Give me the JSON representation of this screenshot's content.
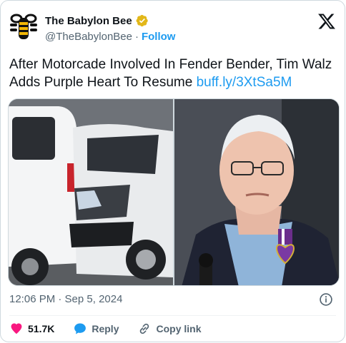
{
  "author": {
    "display_name": "The Babylon Bee",
    "handle": "@TheBabylonBee",
    "separator": "·",
    "follow_label": "Follow"
  },
  "tweet": {
    "text": "After Motorcade Involved In Fender Bender, Tim Walz Adds Purple Heart To Resume",
    "link": "buff.ly/3XtSa5M"
  },
  "meta": {
    "timestamp": "12:06 PM · Sep 5, 2024"
  },
  "actions": {
    "likes": "51.7K",
    "reply_label": "Reply",
    "copy_link_label": "Copy link"
  },
  "icons": {
    "avatar": "babylon-bee-logo",
    "verified": "verified-badge-icon",
    "platform": "x-logo-icon",
    "info": "info-icon",
    "like": "heart-icon",
    "reply": "reply-bubble-icon",
    "copy": "link-icon"
  },
  "colors": {
    "accent": "#1d9bf0",
    "like": "#f91880",
    "verified": "#e2b719",
    "secondary_text": "#536471"
  }
}
